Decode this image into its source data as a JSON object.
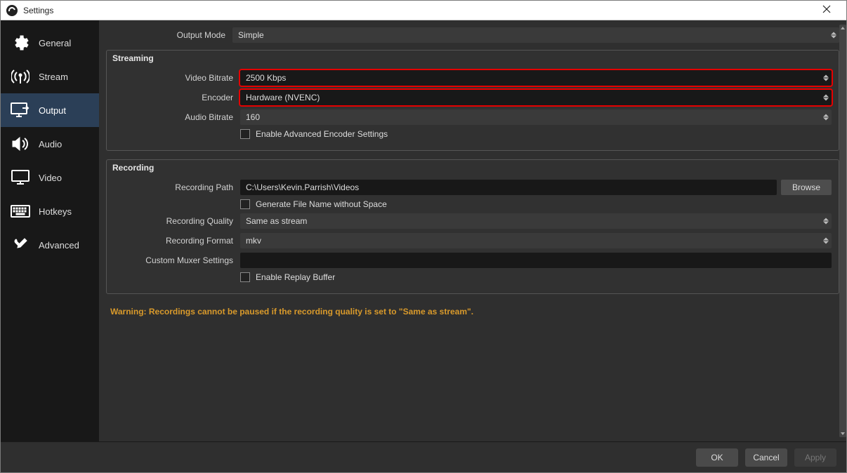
{
  "window": {
    "title": "Settings"
  },
  "sidebar": [
    {
      "label": "General"
    },
    {
      "label": "Stream"
    },
    {
      "label": "Output"
    },
    {
      "label": "Audio"
    },
    {
      "label": "Video"
    },
    {
      "label": "Hotkeys"
    },
    {
      "label": "Advanced"
    }
  ],
  "output": {
    "mode_label": "Output Mode",
    "mode_value": "Simple"
  },
  "streaming": {
    "title": "Streaming",
    "video_bitrate_label": "Video Bitrate",
    "video_bitrate_value": "2500 Kbps",
    "encoder_label": "Encoder",
    "encoder_value": "Hardware (NVENC)",
    "audio_bitrate_label": "Audio Bitrate",
    "audio_bitrate_value": "160",
    "advanced_encoder_label": "Enable Advanced Encoder Settings"
  },
  "recording": {
    "title": "Recording",
    "path_label": "Recording Path",
    "path_value": "C:\\Users\\Kevin.Parrish\\Videos",
    "browse_label": "Browse",
    "nospace_label": "Generate File Name without Space",
    "quality_label": "Recording Quality",
    "quality_value": "Same as stream",
    "format_label": "Recording Format",
    "format_value": "mkv",
    "muxer_label": "Custom Muxer Settings",
    "replay_label": "Enable Replay Buffer"
  },
  "warning": "Warning: Recordings cannot be paused if the recording quality is set to \"Same as stream\".",
  "footer": {
    "ok": "OK",
    "cancel": "Cancel",
    "apply": "Apply"
  }
}
